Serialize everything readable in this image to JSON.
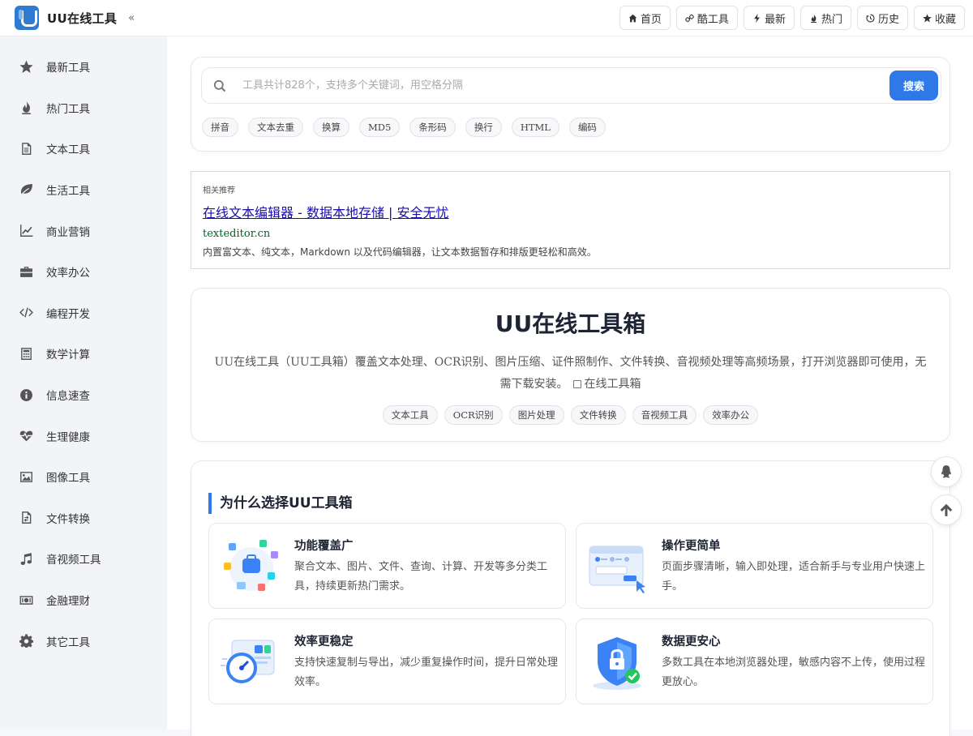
{
  "app": {
    "title": "UU在线工具",
    "collapse_glyph": "«"
  },
  "topnav": [
    {
      "label": "首页",
      "icon": "home-icon"
    },
    {
      "label": "酷工具",
      "icon": "link-icon"
    },
    {
      "label": "最新",
      "icon": "bolt-icon"
    },
    {
      "label": "热门",
      "icon": "fire-icon"
    },
    {
      "label": "历史",
      "icon": "history-icon"
    },
    {
      "label": "收藏",
      "icon": "star-icon"
    }
  ],
  "sidebar": {
    "items": [
      {
        "label": "最新工具",
        "icon": "star-icon"
      },
      {
        "label": "热门工具",
        "icon": "fire-icon"
      },
      {
        "label": "文本工具",
        "icon": "file-text-icon"
      },
      {
        "label": "生活工具",
        "icon": "leaf-icon"
      },
      {
        "label": "商业营销",
        "icon": "chart-line-icon"
      },
      {
        "label": "效率办公",
        "icon": "briefcase-icon"
      },
      {
        "label": "编程开发",
        "icon": "code-icon"
      },
      {
        "label": "数学计算",
        "icon": "calculator-icon"
      },
      {
        "label": "信息速查",
        "icon": "info-icon"
      },
      {
        "label": "生理健康",
        "icon": "heartbeat-icon"
      },
      {
        "label": "图像工具",
        "icon": "image-icon"
      },
      {
        "label": "文件转换",
        "icon": "file-convert-icon"
      },
      {
        "label": "音视频工具",
        "icon": "music-icon"
      },
      {
        "label": "金融理财",
        "icon": "money-icon"
      },
      {
        "label": "其它工具",
        "icon": "gear-icon"
      }
    ]
  },
  "search": {
    "placeholder": "工具共计828个，支持多个关键词，用空格分隔",
    "button_label": "搜索",
    "hot_tags": [
      "拼音",
      "文本去重",
      "换算",
      "MD5",
      "条形码",
      "换行",
      "HTML",
      "编码"
    ]
  },
  "ad": {
    "label": "相关推荐",
    "title": "在线文本编辑器 - 数据本地存储 | 安全无忧",
    "domain": "texteditor.cn",
    "description": "内置富文本、纯文本，Markdown 以及代码编辑器，让文本数据暂存和排版更轻松和高效。"
  },
  "intro": {
    "title": "UU在线工具箱",
    "description": "UU在线工具（UU工具箱）覆盖文本处理、OCR识别、图片压缩、证件照制作、文件转换、音视频处理等高频场景，打开浏览器即可使用，无需下载安装。",
    "bookmark_label": "在线工具箱",
    "tags": [
      "文本工具",
      "OCR识别",
      "图片处理",
      "文件转换",
      "音视频工具",
      "效率办公"
    ]
  },
  "why": {
    "title": "为什么选择UU工具箱",
    "features": [
      {
        "title": "功能覆盖广",
        "description": "聚合文本、图片、文件、查询、计算、开发等多分类工具，持续更新热门需求。"
      },
      {
        "title": "操作更简单",
        "description": "页面步骤清晰，输入即处理，适合新手与专业用户快速上手。"
      },
      {
        "title": "效率更稳定",
        "description": "支持快速复制与导出，减少重复操作时间，提升日常处理效率。"
      },
      {
        "title": "数据更安心",
        "description": "多数工具在本地浏览器处理，敏感内容不上传，使用过程更放心。"
      }
    ]
  },
  "floating": {
    "qq_icon": "qq-icon",
    "top_icon": "arrow-up-icon"
  },
  "colors": {
    "accent": "#2e78e8",
    "ad_link": "#1a0dab",
    "ad_domain": "#006621"
  }
}
